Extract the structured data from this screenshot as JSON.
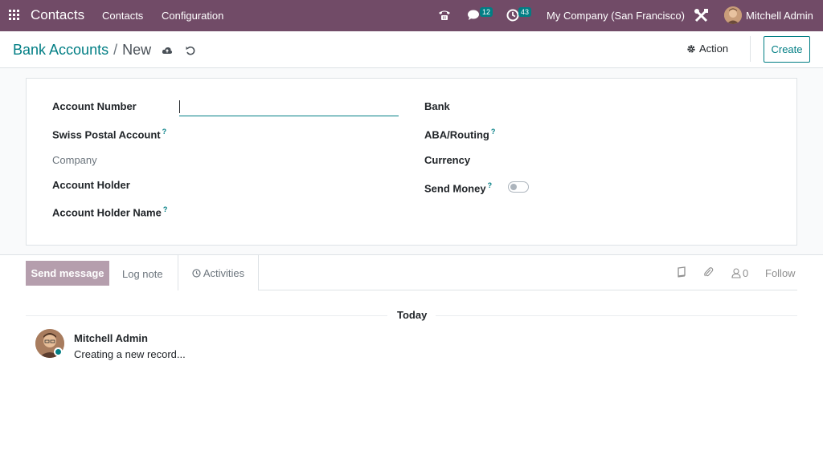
{
  "navbar": {
    "app_name": "Contacts",
    "menus": [
      "Contacts",
      "Configuration"
    ],
    "messages_count": "12",
    "activities_count": "43",
    "company": "My Company (San Francisco)",
    "user": "Mitchell Admin",
    "bg_color": "#714b67"
  },
  "control_panel": {
    "breadcrumb_parent": "Bank Accounts",
    "breadcrumb_separator": "/",
    "breadcrumb_current": "New",
    "action_label": "Action",
    "create_label": "Create"
  },
  "form": {
    "left_fields": {
      "account_number": "Account Number",
      "swiss_postal": "Swiss Postal Account",
      "company": "Company",
      "account_holder": "Account Holder",
      "account_holder_name": "Account Holder Name"
    },
    "right_fields": {
      "bank": "Bank",
      "aba_routing": "ABA/Routing",
      "currency": "Currency",
      "send_money": "Send Money"
    },
    "help_marker": "?",
    "account_number_value": "",
    "send_money_enabled": false
  },
  "chatter": {
    "send_message": "Send message",
    "log_note": "Log note",
    "activities": "Activities",
    "followers_count": "0",
    "follow": "Follow",
    "date_separator": "Today",
    "messages": [
      {
        "author": "Mitchell Admin",
        "body": "Creating a new record..."
      }
    ]
  },
  "colors": {
    "accent": "#017e84",
    "brand": "#714b67",
    "send_button": "#b59ead"
  }
}
